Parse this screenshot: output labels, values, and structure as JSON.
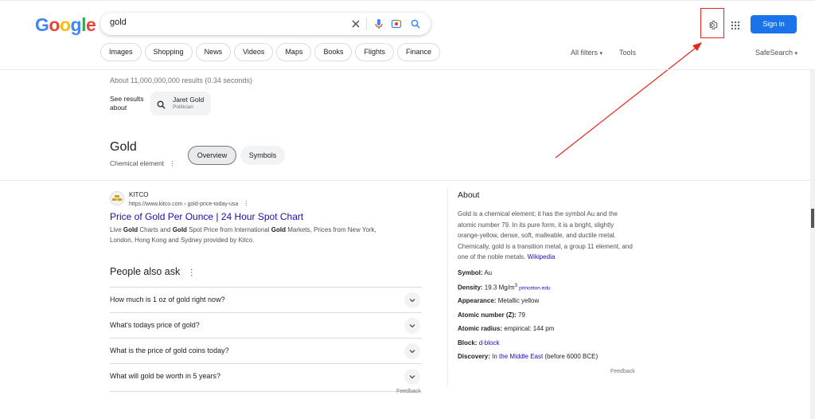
{
  "header": {
    "search_value": "gold",
    "signin_label": "Sign in",
    "logo_letters": [
      {
        "ch": "G",
        "color": "#4285f4"
      },
      {
        "ch": "o",
        "color": "#ea4335"
      },
      {
        "ch": "o",
        "color": "#fbbc05"
      },
      {
        "ch": "g",
        "color": "#4285f4"
      },
      {
        "ch": "l",
        "color": "#34a853"
      },
      {
        "ch": "e",
        "color": "#ea4335"
      }
    ]
  },
  "tabs": [
    "Images",
    "Shopping",
    "News",
    "Videos",
    "Maps",
    "Books",
    "Flights",
    "Finance"
  ],
  "toolbar": {
    "all_filters": "All filters",
    "tools": "Tools",
    "safesearch": "SafeSearch"
  },
  "stats": "About 11,000,000,000 results (0.34 seconds)",
  "see_about": {
    "label": "See results about",
    "name": "Jaret Gold",
    "desc": "Politician"
  },
  "entity": {
    "title": "Gold",
    "subtitle": "Chemical element",
    "tab_overview": "Overview",
    "tab_symbols": "Symbols"
  },
  "result": {
    "site": "KITCO",
    "url": "https://www.kitco.com › gold-price-today-usa",
    "title": "Price of Gold Per Ounce | 24 Hour Spot Chart",
    "snippet_parts": [
      {
        "t": "Live ",
        "b": false
      },
      {
        "t": "Gold",
        "b": true
      },
      {
        "t": " Charts and ",
        "b": false
      },
      {
        "t": "Gold",
        "b": true
      },
      {
        "t": " Spot Price from International ",
        "b": false
      },
      {
        "t": "Gold",
        "b": true
      },
      {
        "t": " Markets, Prices from New York, London, Hong Kong and Sydney provided by Kitco.",
        "b": false
      }
    ]
  },
  "paa": {
    "title": "People also ask",
    "questions": [
      "How much is 1 oz of gold right now?",
      "What's todays price of gold?",
      "What is the price of gold coins today?",
      "What will gold be worth in 5 years?"
    ],
    "feedback": "Feedback"
  },
  "about": {
    "title": "About",
    "text": "Gold is a chemical element; it has the symbol Au and the atomic number 79. In its pure form, it is a bright, slightly orange-yellow, dense, soft, malleable, and ductile metal. Chemically, gold is a transition metal, a group 11 element, and one of the noble metals.",
    "wiki": "Wikipedia",
    "facts": [
      {
        "k": "Symbol:",
        "v": "Au"
      },
      {
        "k": "Density:",
        "v": "19.3 Mg/m",
        "sup": "3",
        "src": "princeton.edu"
      },
      {
        "k": "Appearance:",
        "v": "Metallic yellow"
      },
      {
        "k": "Atomic number (Z):",
        "v": "79"
      },
      {
        "k": "Atomic radius:",
        "v": "empirical: 144 pm"
      },
      {
        "k": "Block:",
        "link": "d-block"
      },
      {
        "k": "Discovery:",
        "link_pre": "In the",
        "link": "Middle East",
        "v": " (before 6000 BCE)"
      }
    ],
    "feedback": "Feedback"
  }
}
